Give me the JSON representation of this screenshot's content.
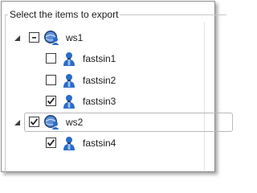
{
  "export_panel": {
    "title": "Select the items to export",
    "tree": [
      {
        "label": "ws1",
        "kind": "workspace",
        "expanded": true,
        "check_state": "indeterminate",
        "children": [
          {
            "label": "fastsin1",
            "kind": "user",
            "checked": false
          },
          {
            "label": "fastsin2",
            "kind": "user",
            "checked": false
          },
          {
            "label": "fastsin3",
            "kind": "user",
            "checked": true
          }
        ]
      },
      {
        "label": "ws2",
        "kind": "workspace",
        "expanded": true,
        "check_state": "checked",
        "children": [
          {
            "label": "fastsin4",
            "kind": "user",
            "checked": true
          }
        ]
      }
    ],
    "colors": {
      "accent_blue": "#2a6cc8",
      "icon_dark": "#1d3f73",
      "checkbox_border": "#3c3c3c"
    },
    "icons": {
      "expander": "triangle-expanded-icon",
      "workspace": "globe-user-icon",
      "user": "user-icon"
    }
  }
}
